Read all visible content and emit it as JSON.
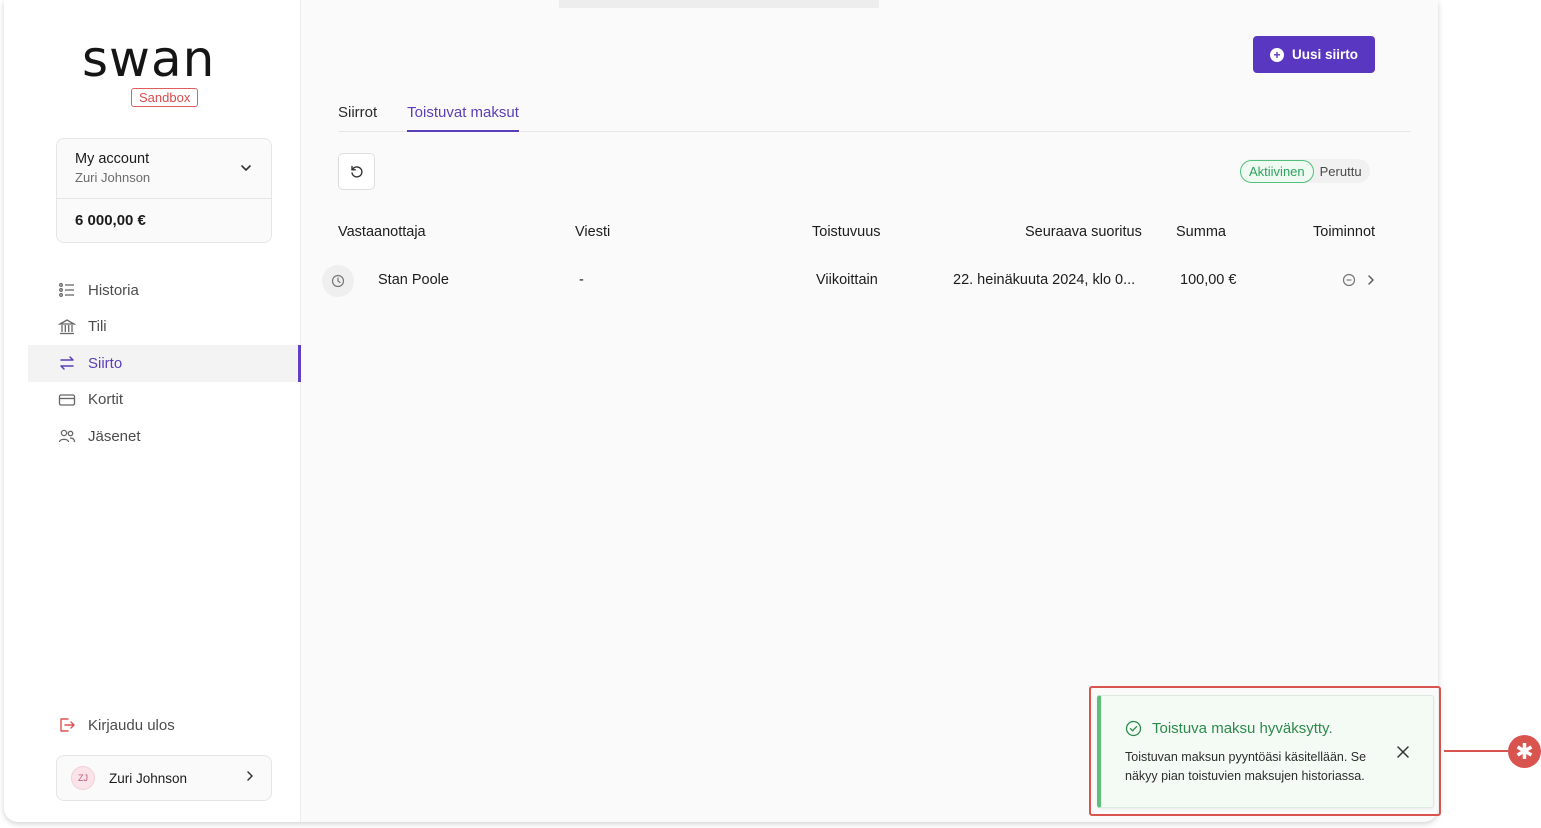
{
  "brand": {
    "logo": "swan",
    "env_badge": "Sandbox",
    "accent": "#5a37c0"
  },
  "account": {
    "name": "My account",
    "holder": "Zuri Johnson",
    "balance": "6 000,00 €"
  },
  "nav": {
    "items": [
      {
        "label": "Historia",
        "icon": "list-icon"
      },
      {
        "label": "Tili",
        "icon": "bank-icon"
      },
      {
        "label": "Siirto",
        "icon": "transfer-icon",
        "active": true
      },
      {
        "label": "Kortit",
        "icon": "card-icon"
      },
      {
        "label": "Jäsenet",
        "icon": "members-icon"
      }
    ],
    "logout": "Kirjaudu ulos"
  },
  "user": {
    "initials": "ZJ",
    "name": "Zuri Johnson"
  },
  "toolbar": {
    "new_transfer": "Uusi siirto"
  },
  "tabs": [
    {
      "label": "Siirrot"
    },
    {
      "label": "Toistuvat maksut",
      "active": true
    }
  ],
  "filter": {
    "active_label": "Aktiivinen",
    "other_label": "Peruttu"
  },
  "table": {
    "columns": [
      "Vastaanottaja",
      "Viesti",
      "Toistuvuus",
      "Seuraava suoritus",
      "Summa",
      "Toiminnot"
    ],
    "rows": [
      {
        "recipient": "Stan Poole",
        "message": "-",
        "frequency": "Viikoittain",
        "next": "22. heinäkuuta 2024, klo 0...",
        "amount": "100,00 €"
      }
    ]
  },
  "toast": {
    "title": "Toistuva maksu hyväksytty.",
    "message": "Toistuvan maksun pyyntöäsi käsitellään. Se näkyy pian toistuvien maksujen historiassa.",
    "color": "#2e8a4c"
  },
  "callout": {
    "symbol": "✱",
    "color": "#d9534f"
  }
}
